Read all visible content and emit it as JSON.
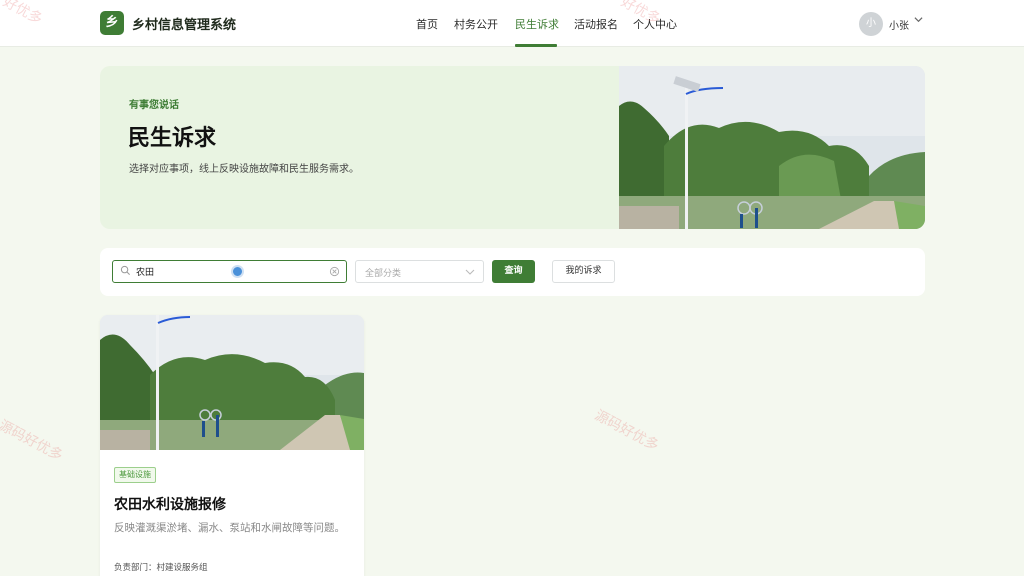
{
  "header": {
    "logo_glyph": "乡",
    "app_title": "乡村信息管理系统",
    "nav": [
      {
        "label": "首页",
        "active": false
      },
      {
        "label": "村务公开",
        "active": false
      },
      {
        "label": "民生诉求",
        "active": true
      },
      {
        "label": "活动报名",
        "active": false
      },
      {
        "label": "个人中心",
        "active": false
      }
    ],
    "user": {
      "avatar_text": "小",
      "name": "小张",
      "caret": "chevron-down-icon"
    }
  },
  "hero": {
    "tag": "有事您说话",
    "title": "民生诉求",
    "description": "选择对应事项，线上反映设施故障和民生服务需求。",
    "image": "rural-road-streetlight-photo"
  },
  "filters": {
    "search_value": "农田",
    "category_placeholder": "全部分类",
    "query_label": "查询",
    "my_requests_label": "我的诉求"
  },
  "cards": [
    {
      "image": "rural-road-streetlight-photo",
      "badge": "基础设施",
      "title": "农田水利设施报修",
      "description": "反映灌溉渠淤堵、漏水、泵站和水闸故障等问题。",
      "department": "负责部门：村建设服务组"
    }
  ],
  "watermark": {
    "text_a": "好优多",
    "text_b": "源码好优多",
    "text_c": "源码好优多",
    "text_d": "好优多"
  },
  "colors": {
    "brand": "#3f7d35",
    "page_bg": "#f4f8ef",
    "hero_bg": "#e9f4e2",
    "badge_border": "#9ccf8c"
  }
}
